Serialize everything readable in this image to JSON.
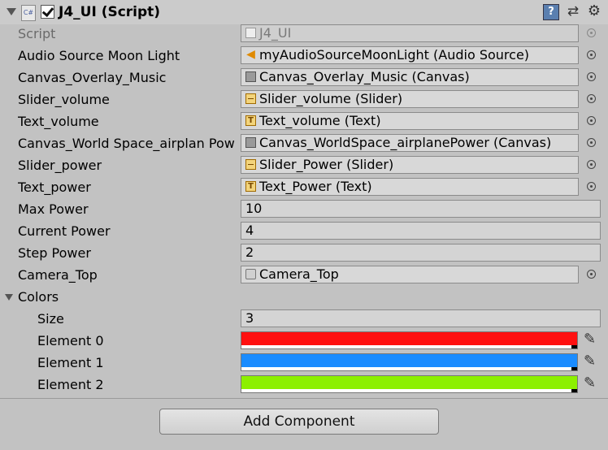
{
  "component": {
    "title": "J4_UI (Script)",
    "icon_text": "C#",
    "enabled": true
  },
  "fields": [
    {
      "label": "Script",
      "value": "J4_UI",
      "type": "object",
      "icon": "script-icon",
      "disabled": true
    },
    {
      "label": "Audio Source Moon Light",
      "value": "myAudioSourceMoonLight (Audio Source)",
      "type": "object",
      "icon": "audio-icon"
    },
    {
      "label": "Canvas_Overlay_Music",
      "value": "Canvas_Overlay_Music (Canvas)",
      "type": "object",
      "icon": "canvas-icon"
    },
    {
      "label": "Slider_volume",
      "value": "Slider_volume (Slider)",
      "type": "object",
      "icon": "slider-icon"
    },
    {
      "label": "Text_volume",
      "value": "Text_volume (Text)",
      "type": "object",
      "icon": "text-icon"
    },
    {
      "label": "Canvas_World Space_airplan Pow",
      "value": "Canvas_WorldSpace_airplanePower (Canvas)",
      "type": "object",
      "icon": "canvas-icon"
    },
    {
      "label": "Slider_power",
      "value": "Slider_Power (Slider)",
      "type": "object",
      "icon": "slider-icon"
    },
    {
      "label": "Text_power",
      "value": "Text_Power (Text)",
      "type": "object",
      "icon": "text-icon"
    },
    {
      "label": "Max Power",
      "value": "10",
      "type": "number"
    },
    {
      "label": "Current Power",
      "value": "4",
      "type": "number"
    },
    {
      "label": "Step Power",
      "value": "2",
      "type": "number"
    },
    {
      "label": "Camera_Top",
      "value": "Camera_Top",
      "type": "object",
      "icon": "camera-icon"
    }
  ],
  "colors": {
    "label": "Colors",
    "size_label": "Size",
    "size": "3",
    "elements": [
      {
        "label": "Element 0",
        "color": "#ff1010"
      },
      {
        "label": "Element 1",
        "color": "#1a8cff"
      },
      {
        "label": "Element 2",
        "color": "#8cf000"
      }
    ]
  },
  "add_component_label": "Add Component",
  "header_icons": [
    "help-icon",
    "preset-icon",
    "gear-icon"
  ]
}
